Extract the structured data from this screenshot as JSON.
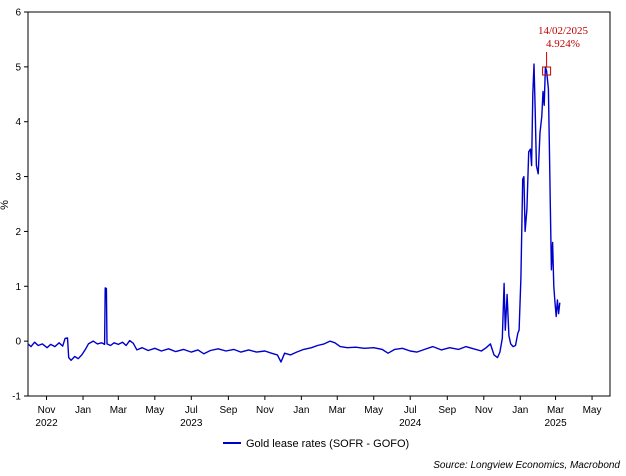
{
  "chart_data": {
    "type": "line",
    "title": "",
    "xlabel": "",
    "ylabel": "%",
    "ylim": [
      -1,
      6
    ],
    "yticks": [
      "-1",
      "0",
      "1",
      "2",
      "3",
      "4",
      "5",
      "6"
    ],
    "xlim": [
      "2022-10-01",
      "2025-05-31"
    ],
    "xticks": [
      {
        "date": "2022-11-01",
        "label": "Nov"
      },
      {
        "date": "2023-01-01",
        "label": "Jan"
      },
      {
        "date": "2023-03-01",
        "label": "Mar"
      },
      {
        "date": "2023-05-01",
        "label": "May"
      },
      {
        "date": "2023-07-01",
        "label": "Jul"
      },
      {
        "date": "2023-09-01",
        "label": "Sep"
      },
      {
        "date": "2023-11-01",
        "label": "Nov"
      },
      {
        "date": "2024-01-01",
        "label": "Jan"
      },
      {
        "date": "2024-03-01",
        "label": "Mar"
      },
      {
        "date": "2024-05-01",
        "label": "May"
      },
      {
        "date": "2024-07-01",
        "label": "Jul"
      },
      {
        "date": "2024-09-01",
        "label": "Sep"
      },
      {
        "date": "2024-11-01",
        "label": "Nov"
      },
      {
        "date": "2025-01-01",
        "label": "Jan"
      },
      {
        "date": "2025-03-01",
        "label": "Mar"
      },
      {
        "date": "2025-05-01",
        "label": "May"
      }
    ],
    "year_labels": [
      {
        "date": "2022-11-01",
        "label": "2022"
      },
      {
        "date": "2023-07-01",
        "label": "2023"
      },
      {
        "date": "2024-07-01",
        "label": "2024"
      },
      {
        "date": "2025-03-01",
        "label": "2025"
      }
    ],
    "grid": false,
    "legend_position": "bottom-center",
    "series": [
      {
        "name": "Gold lease rates (SOFR - GOFO)",
        "color": "#0000cc",
        "points": [
          [
            "2022-10-01",
            -0.05
          ],
          [
            "2022-10-06",
            -0.1
          ],
          [
            "2022-10-12",
            -0.02
          ],
          [
            "2022-10-18",
            -0.08
          ],
          [
            "2022-10-25",
            -0.05
          ],
          [
            "2022-11-02",
            -0.12
          ],
          [
            "2022-11-08",
            -0.06
          ],
          [
            "2022-11-15",
            -0.1
          ],
          [
            "2022-11-22",
            -0.03
          ],
          [
            "2022-11-28",
            -0.09
          ],
          [
            "2022-12-02",
            0.05
          ],
          [
            "2022-12-06",
            0.06
          ],
          [
            "2022-12-08",
            -0.3
          ],
          [
            "2022-12-12",
            -0.35
          ],
          [
            "2022-12-18",
            -0.28
          ],
          [
            "2022-12-24",
            -0.32
          ],
          [
            "2022-12-30",
            -0.25
          ],
          [
            "2023-01-05",
            -0.15
          ],
          [
            "2023-01-10",
            -0.05
          ],
          [
            "2023-01-18",
            0.0
          ],
          [
            "2023-01-25",
            -0.05
          ],
          [
            "2023-02-01",
            -0.03
          ],
          [
            "2023-02-06",
            -0.06
          ],
          [
            "2023-02-07",
            0.97
          ],
          [
            "2023-02-09",
            0.96
          ],
          [
            "2023-02-10",
            -0.05
          ],
          [
            "2023-02-16",
            -0.08
          ],
          [
            "2023-02-22",
            -0.03
          ],
          [
            "2023-03-01",
            -0.06
          ],
          [
            "2023-03-08",
            -0.02
          ],
          [
            "2023-03-14",
            -0.08
          ],
          [
            "2023-03-20",
            0.01
          ],
          [
            "2023-03-26",
            -0.04
          ],
          [
            "2023-04-01",
            -0.16
          ],
          [
            "2023-04-10",
            -0.12
          ],
          [
            "2023-04-20",
            -0.17
          ],
          [
            "2023-05-01",
            -0.13
          ],
          [
            "2023-05-12",
            -0.18
          ],
          [
            "2023-05-24",
            -0.14
          ],
          [
            "2023-06-05",
            -0.19
          ],
          [
            "2023-06-18",
            -0.15
          ],
          [
            "2023-07-01",
            -0.2
          ],
          [
            "2023-07-12",
            -0.16
          ],
          [
            "2023-07-22",
            -0.23
          ],
          [
            "2023-08-02",
            -0.17
          ],
          [
            "2023-08-15",
            -0.14
          ],
          [
            "2023-08-28",
            -0.18
          ],
          [
            "2023-09-10",
            -0.15
          ],
          [
            "2023-09-22",
            -0.2
          ],
          [
            "2023-10-05",
            -0.16
          ],
          [
            "2023-10-18",
            -0.2
          ],
          [
            "2023-11-01",
            -0.18
          ],
          [
            "2023-11-12",
            -0.22
          ],
          [
            "2023-11-22",
            -0.25
          ],
          [
            "2023-11-28",
            -0.38
          ],
          [
            "2023-12-04",
            -0.22
          ],
          [
            "2023-12-14",
            -0.25
          ],
          [
            "2023-12-24",
            -0.2
          ],
          [
            "2024-01-05",
            -0.15
          ],
          [
            "2024-01-18",
            -0.12
          ],
          [
            "2024-01-28",
            -0.08
          ],
          [
            "2024-02-08",
            -0.05
          ],
          [
            "2024-02-18",
            0.0
          ],
          [
            "2024-02-26",
            -0.03
          ],
          [
            "2024-03-06",
            -0.1
          ],
          [
            "2024-03-18",
            -0.12
          ],
          [
            "2024-04-01",
            -0.11
          ],
          [
            "2024-04-15",
            -0.13
          ],
          [
            "2024-05-01",
            -0.12
          ],
          [
            "2024-05-15",
            -0.15
          ],
          [
            "2024-05-25",
            -0.22
          ],
          [
            "2024-06-05",
            -0.15
          ],
          [
            "2024-06-18",
            -0.13
          ],
          [
            "2024-07-01",
            -0.18
          ],
          [
            "2024-07-12",
            -0.2
          ],
          [
            "2024-07-25",
            -0.15
          ],
          [
            "2024-08-08",
            -0.1
          ],
          [
            "2024-08-22",
            -0.16
          ],
          [
            "2024-09-05",
            -0.12
          ],
          [
            "2024-09-20",
            -0.15
          ],
          [
            "2024-10-02",
            -0.1
          ],
          [
            "2024-10-15",
            -0.14
          ],
          [
            "2024-10-28",
            -0.18
          ],
          [
            "2024-11-05",
            -0.12
          ],
          [
            "2024-11-12",
            -0.05
          ],
          [
            "2024-11-18",
            -0.25
          ],
          [
            "2024-11-24",
            -0.3
          ],
          [
            "2024-11-28",
            -0.2
          ],
          [
            "2024-12-02",
            0.05
          ],
          [
            "2024-12-05",
            1.05
          ],
          [
            "2024-12-07",
            0.2
          ],
          [
            "2024-12-10",
            0.85
          ],
          [
            "2024-12-13",
            0.1
          ],
          [
            "2024-12-16",
            -0.05
          ],
          [
            "2024-12-20",
            -0.1
          ],
          [
            "2024-12-24",
            -0.08
          ],
          [
            "2024-12-28",
            0.15
          ],
          [
            "2024-12-30",
            0.2
          ],
          [
            "2025-01-02",
            1.15
          ],
          [
            "2025-01-05",
            2.95
          ],
          [
            "2025-01-07",
            3.0
          ],
          [
            "2025-01-09",
            2.0
          ],
          [
            "2025-01-12",
            2.4
          ],
          [
            "2025-01-15",
            3.45
          ],
          [
            "2025-01-18",
            3.5
          ],
          [
            "2025-01-20",
            3.2
          ],
          [
            "2025-01-22",
            4.5
          ],
          [
            "2025-01-24",
            5.05
          ],
          [
            "2025-01-26",
            4.2
          ],
          [
            "2025-01-28",
            3.2
          ],
          [
            "2025-01-31",
            3.05
          ],
          [
            "2025-02-03",
            3.8
          ],
          [
            "2025-02-06",
            4.1
          ],
          [
            "2025-02-08",
            4.55
          ],
          [
            "2025-02-10",
            4.3
          ],
          [
            "2025-02-12",
            5.0
          ],
          [
            "2025-02-14",
            4.924
          ],
          [
            "2025-02-17",
            4.6
          ],
          [
            "2025-02-19",
            3.3
          ],
          [
            "2025-02-20",
            2.6
          ],
          [
            "2025-02-22",
            1.3
          ],
          [
            "2025-02-24",
            1.8
          ],
          [
            "2025-02-26",
            1.0
          ],
          [
            "2025-02-28",
            0.7
          ],
          [
            "2025-03-02",
            0.45
          ],
          [
            "2025-03-04",
            0.75
          ],
          [
            "2025-03-06",
            0.5
          ],
          [
            "2025-03-08",
            0.7
          ]
        ]
      }
    ],
    "annotation": {
      "date_label": "14/02/2025",
      "value_label": "4.924%",
      "x": "2025-02-14",
      "y": 4.924,
      "color": "#cc0000"
    },
    "source": "Source: Longview Economics, Macrobond"
  }
}
